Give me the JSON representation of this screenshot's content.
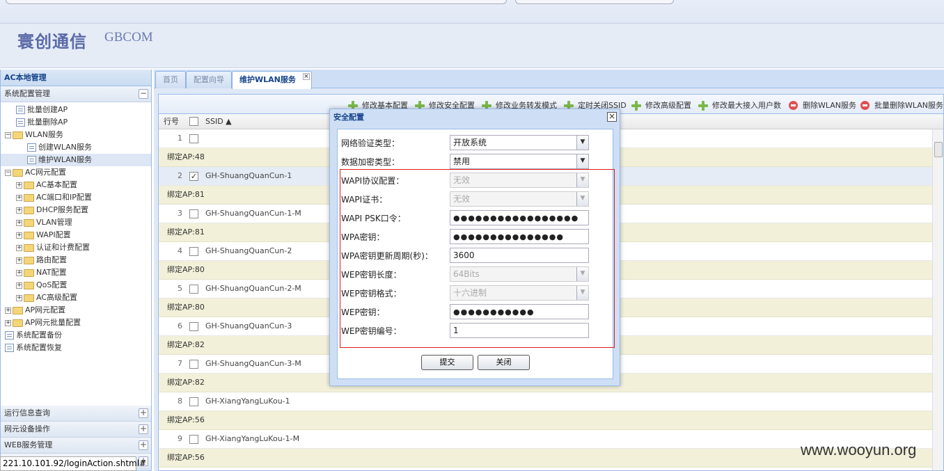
{
  "brand": {
    "cn": "寰创通信",
    "en": "GBCOM"
  },
  "sidebar": {
    "title": "AC本地管理",
    "section": "系统配置管理",
    "items": [
      {
        "label": "批量创建AP",
        "kind": "leaf",
        "level": 1
      },
      {
        "label": "批量删除AP",
        "kind": "leaf",
        "level": 1
      },
      {
        "label": "WLAN服务",
        "kind": "folder-open",
        "level": 0
      },
      {
        "label": "创建WLAN服务",
        "kind": "leaf",
        "level": 2
      },
      {
        "label": "维护WLAN服务",
        "kind": "leaf",
        "level": 2,
        "selected": true
      },
      {
        "label": "AC网元配置",
        "kind": "folder-open",
        "level": 0
      },
      {
        "label": "AC基本配置",
        "kind": "folder",
        "level": 1
      },
      {
        "label": "AC端口和IP配置",
        "kind": "folder",
        "level": 1
      },
      {
        "label": "DHCP服务配置",
        "kind": "folder",
        "level": 1
      },
      {
        "label": "VLAN管理",
        "kind": "folder",
        "level": 1
      },
      {
        "label": "WAPI配置",
        "kind": "folder",
        "level": 1
      },
      {
        "label": "认证和计费配置",
        "kind": "folder",
        "level": 1
      },
      {
        "label": "路由配置",
        "kind": "folder",
        "level": 1
      },
      {
        "label": "NAT配置",
        "kind": "folder",
        "level": 1
      },
      {
        "label": "QoS配置",
        "kind": "folder",
        "level": 1
      },
      {
        "label": "AC高级配置",
        "kind": "folder",
        "level": 1
      },
      {
        "label": "AP网元配置",
        "kind": "folder",
        "level": 0
      },
      {
        "label": "AP网元批量配置",
        "kind": "folder",
        "level": 0
      },
      {
        "label": "系统配置备份",
        "kind": "leaf",
        "level": 0
      },
      {
        "label": "系统配置恢复",
        "kind": "leaf",
        "level": 0
      }
    ],
    "bottom": [
      "运行信息查询",
      "网元设备操作",
      "WEB服务管理"
    ],
    "collapse_glyph": "−",
    "expand_glyph": "+"
  },
  "status_url": "221.10.101.92/loginAction.shtml#",
  "tabs": [
    "首页",
    "配置向导",
    "维护WLAN服务"
  ],
  "tab_close": "×",
  "toolbar": [
    {
      "label": "修改基本配置",
      "icon": "plus-icon"
    },
    {
      "label": "修改安全配置",
      "icon": "plus-icon"
    },
    {
      "label": "修改业务转发模式",
      "icon": "plus-icon"
    },
    {
      "label": "定时关闭SSID",
      "icon": "plus-icon"
    },
    {
      "label": "修改高级配置",
      "icon": "plus-icon"
    },
    {
      "label": "修改最大接入用户数",
      "icon": "plus-icon"
    },
    {
      "label": "删除WLAN服务",
      "icon": "minus-icon"
    },
    {
      "label": "批量删除WLAN服务",
      "icon": "minus-icon"
    }
  ],
  "grid": {
    "headers": {
      "row": "行号",
      "ssid": "SSID ▲"
    },
    "rows": [
      {
        "num": "1",
        "ssid": "",
        "checked": false,
        "bind": "绑定AP:48"
      },
      {
        "num": "2",
        "ssid": "GH-ShuangQuanCun-1",
        "checked": true,
        "bind": "绑定AP:81"
      },
      {
        "num": "3",
        "ssid": "GH-ShuangQuanCun-1-M",
        "checked": false,
        "bind": "绑定AP:81"
      },
      {
        "num": "4",
        "ssid": "GH-ShuangQuanCun-2",
        "checked": false,
        "bind": "绑定AP:80"
      },
      {
        "num": "5",
        "ssid": "GH-ShuangQuanCun-2-M",
        "checked": false,
        "bind": "绑定AP:80"
      },
      {
        "num": "6",
        "ssid": "GH-ShuangQuanCun-3",
        "checked": false,
        "bind": "绑定AP:82"
      },
      {
        "num": "7",
        "ssid": "GH-ShuangQuanCun-3-M",
        "checked": false,
        "bind": "绑定AP:82"
      },
      {
        "num": "8",
        "ssid": "GH-XiangYangLuKou-1",
        "checked": false,
        "bind": "绑定AP:56"
      },
      {
        "num": "9",
        "ssid": "GH-XiangYangLuKou-1-M",
        "checked": false,
        "bind": "绑定AP:56"
      }
    ],
    "check_glyph": "✓"
  },
  "dialog": {
    "title": "安全配置",
    "close": "×",
    "fields": [
      {
        "label": "网络验证类型：",
        "value": "开放系统",
        "type": "select",
        "disabled": false
      },
      {
        "label": "数据加密类型：",
        "value": "禁用",
        "type": "select",
        "disabled": false
      },
      {
        "label": "WAPI协议配置：",
        "value": "无效",
        "type": "select",
        "disabled": true
      },
      {
        "label": "WAPI证书：",
        "value": "无效",
        "type": "select",
        "disabled": true
      },
      {
        "label": "WAPI PSK口令：",
        "value": "●●●●●●●●●●●●●●●●●",
        "type": "password",
        "disabled": false
      },
      {
        "label": "WPA密钥：",
        "value": "●●●●●●●●●●●●●●●",
        "type": "password",
        "disabled": false
      },
      {
        "label": "WPA密钥更新周期(秒)：",
        "value": "3600",
        "type": "text",
        "disabled": false
      },
      {
        "label": "WEP密钥长度：",
        "value": "64Bits",
        "type": "select",
        "disabled": true
      },
      {
        "label": "WEP密钥格式：",
        "value": "十六进制",
        "type": "select",
        "disabled": true
      },
      {
        "label": "WEP密钥：",
        "value": "●●●●●●●●●●●",
        "type": "password",
        "disabled": false
      },
      {
        "label": "WEP密钥编号：",
        "value": "1",
        "type": "text",
        "disabled": false
      }
    ],
    "submit": "提交",
    "close_btn": "关闭",
    "arrow_glyph": "▼"
  },
  "watermark": "www.wooyun.org"
}
